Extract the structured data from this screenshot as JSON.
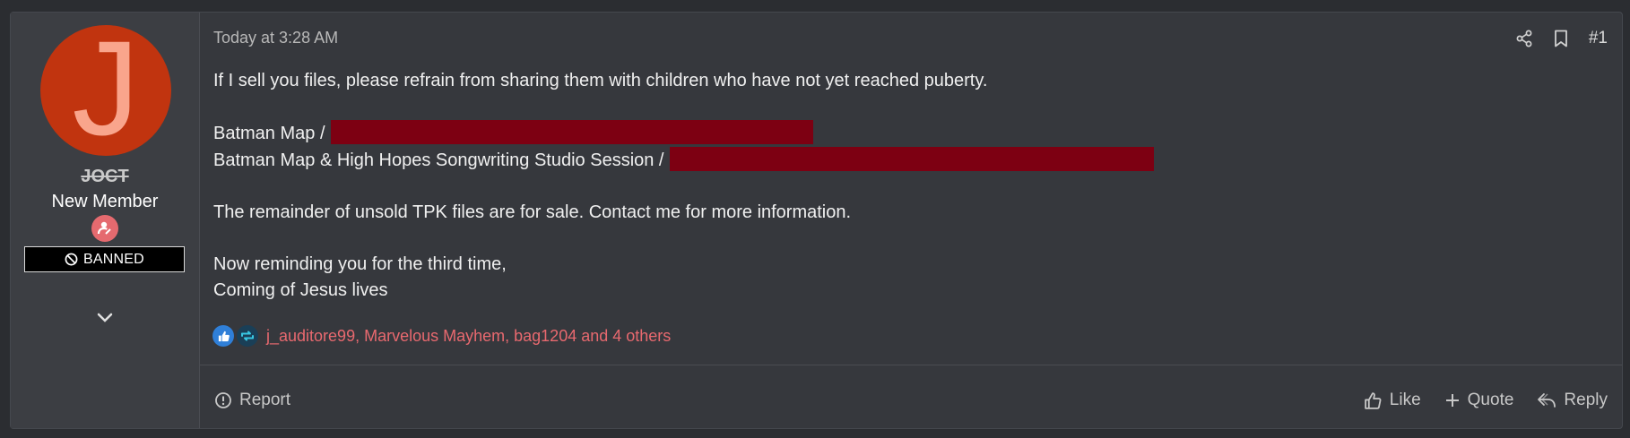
{
  "user": {
    "avatar_letter": "J",
    "username": "JOCT",
    "title": "New Member",
    "banned_label": "BANNED",
    "avatar_color": "#c1340f"
  },
  "post": {
    "date": "Today at 3:28 AM",
    "number": "#1",
    "lines": {
      "l1": "If I sell you files, please refrain from sharing them with children who have not yet reached puberty.",
      "l2": "Batman Map /",
      "l3": "Batman Map & High Hopes Songwriting Studio Session /",
      "l4": "The remainder of unsold TPK files are for sale. Contact me for more information.",
      "l5": "Now reminding you for the third time,",
      "l6": "Coming of Jesus lives"
    },
    "reactions_text": "j_auditore99, Marvelous Mayhem, bag1204 and 4 others"
  },
  "footer": {
    "report_label": "Report",
    "like_label": "Like",
    "quote_label": "Quote",
    "reply_label": "Reply"
  },
  "colors": {
    "redaction": "#7d0012",
    "reaction_names": "#e8696f"
  }
}
